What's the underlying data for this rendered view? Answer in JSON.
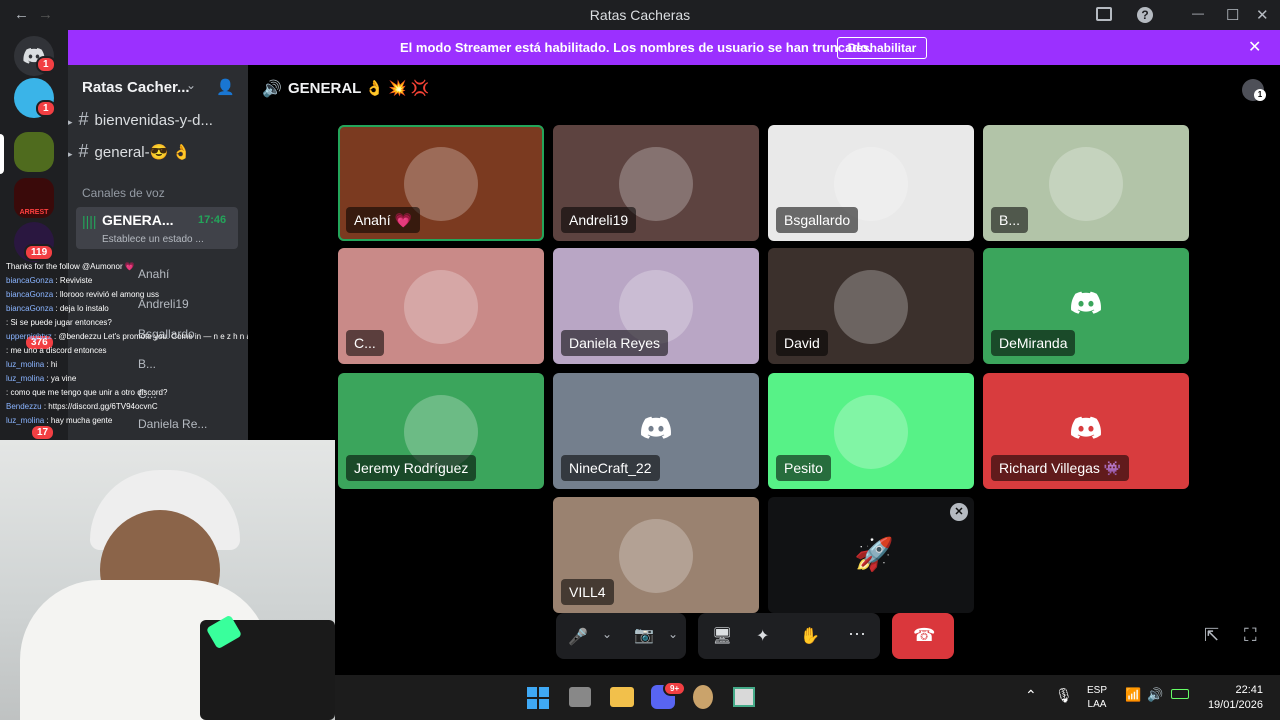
{
  "window": {
    "title": "Ratas Cacheras",
    "back": "←",
    "forward": "→",
    "min": "—",
    "max": "☐",
    "close": "✕"
  },
  "banner": {
    "message": "El modo Streamer está habilitado. Los nombres de usuario se han truncado.",
    "button": "Deshabilitar",
    "close": "✕"
  },
  "rail": {
    "badges": [
      "1",
      "1",
      "119",
      "376",
      "17"
    ],
    "server_label": "ARREST"
  },
  "server": {
    "name": "Ratas Cacher...",
    "text_channels": [
      {
        "name": "bienvenidas-y-d..."
      },
      {
        "name": "general-😎 👌"
      }
    ],
    "voice_category": "Canales de voz",
    "voice_channel": {
      "name": "GENERA...",
      "time": "17:46",
      "status": "Establece un estado ..."
    },
    "voice_members": [
      "Anahí",
      "Andreli19",
      "Bsgallardo",
      "B...",
      "C...",
      "Daniela Re..."
    ]
  },
  "chat_overlay": [
    {
      "user": "",
      "text": "Thanks for the follow @Aumonor 💗"
    },
    {
      "user": "biancaGonza",
      "text": "Reviviste"
    },
    {
      "user": "biancaGonza",
      "text": "llorooo revivió el among uss"
    },
    {
      "user": "biancaGonza",
      "text": "deja lo instalo"
    },
    {
      "user": "",
      "text": "Si se puede jugar entonces?"
    },
    {
      "user": "uppernightxz",
      "text": "@bendezzu Let's promote you. Come in — n e z h n a . c o m"
    },
    {
      "user": "",
      "text": "me uno a discord entonces"
    },
    {
      "user": "luz_molina",
      "text": "hi"
    },
    {
      "user": "luz_molina",
      "text": "ya vine"
    },
    {
      "user": "",
      "text": "como que me tengo que unir a otro discord?"
    },
    {
      "user": "Bendezzu",
      "text": "https://discord.gg/6TV94ocvnC"
    },
    {
      "user": "luz_molina",
      "text": "hay mucha gente"
    }
  ],
  "voice": {
    "channel_title": "GENERAL 👌 💥 💢",
    "notif": "1",
    "tiles": [
      {
        "name": "Anahí 💗",
        "bg": "#7b3a20",
        "type": "avatar"
      },
      {
        "name": "Andreli19",
        "bg": "#5d4340",
        "type": "avatar"
      },
      {
        "name": "Bsgallardo",
        "bg": "#e9e9e9",
        "type": "avatar"
      },
      {
        "name": "B...",
        "bg": "#b2c4a8",
        "type": "avatar"
      },
      {
        "name": "C...",
        "bg": "#c98a88",
        "type": "avatar"
      },
      {
        "name": "Daniela Reyes",
        "bg": "#b9a6c5",
        "type": "avatar"
      },
      {
        "name": "David",
        "bg": "#3b302c",
        "type": "avatar"
      },
      {
        "name": "DeMiranda",
        "bg": "#3ba55c",
        "type": "discord"
      },
      {
        "name": "Jeremy Rodríguez",
        "bg": "#3ba55c",
        "type": "avatar"
      },
      {
        "name": "NineCraft_22",
        "bg": "#747f8d",
        "type": "discord"
      },
      {
        "name": "Pesito",
        "bg": "#57f287",
        "type": "avatar"
      },
      {
        "name": "Richard Villegas 👾",
        "bg": "#d83c3e",
        "type": "discord"
      },
      {
        "name": "VILL4",
        "bg": "#9a8270",
        "type": "avatar"
      }
    ]
  },
  "taskbar": {
    "lang1": "ESP",
    "lang2": "LAA",
    "time": "22:41",
    "date": "19/01/2026",
    "discord_badge": "9+"
  }
}
